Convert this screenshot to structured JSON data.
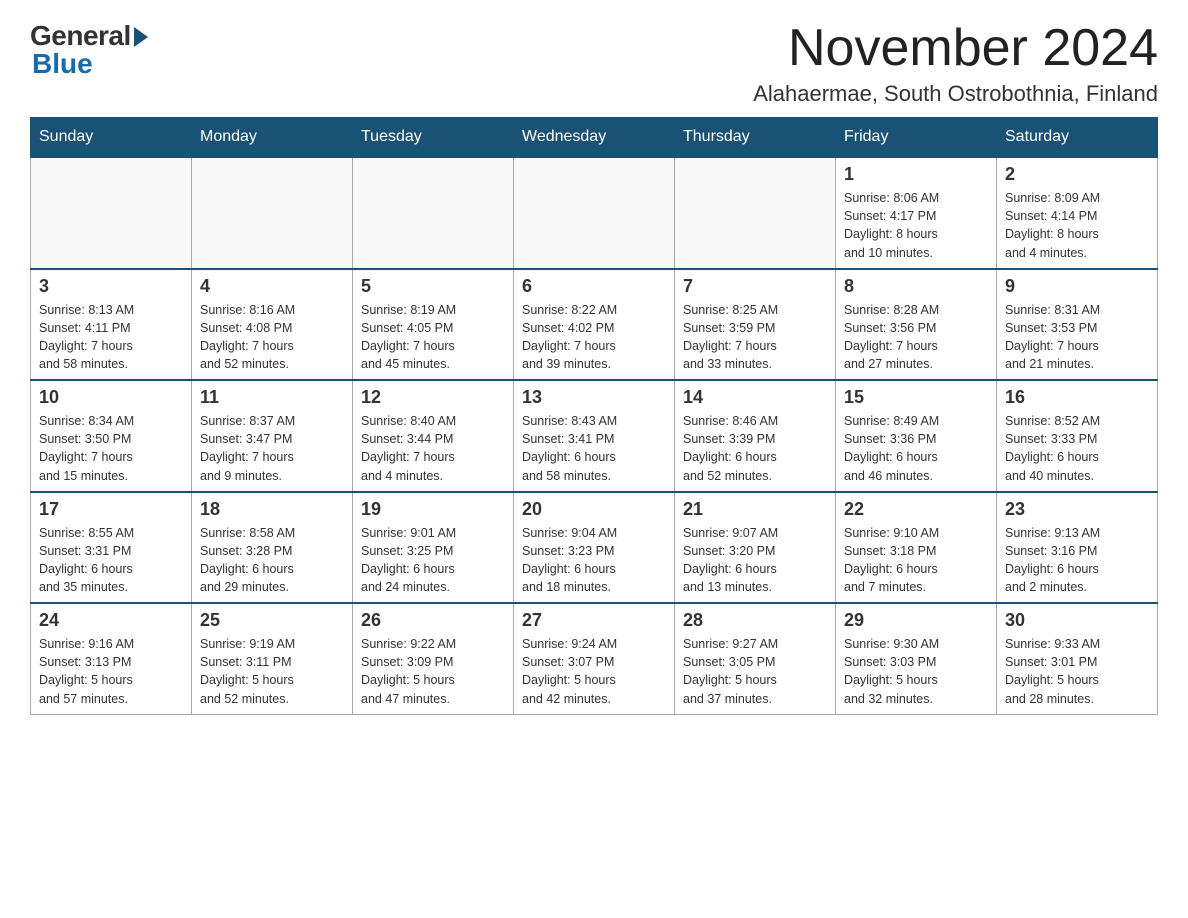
{
  "logo": {
    "general": "General",
    "blue": "Blue"
  },
  "header": {
    "month_year": "November 2024",
    "location": "Alahaermae, South Ostrobothnia, Finland"
  },
  "weekdays": [
    "Sunday",
    "Monday",
    "Tuesday",
    "Wednesday",
    "Thursday",
    "Friday",
    "Saturday"
  ],
  "weeks": [
    {
      "days": [
        {
          "number": "",
          "info": ""
        },
        {
          "number": "",
          "info": ""
        },
        {
          "number": "",
          "info": ""
        },
        {
          "number": "",
          "info": ""
        },
        {
          "number": "",
          "info": ""
        },
        {
          "number": "1",
          "info": "Sunrise: 8:06 AM\nSunset: 4:17 PM\nDaylight: 8 hours\nand 10 minutes."
        },
        {
          "number": "2",
          "info": "Sunrise: 8:09 AM\nSunset: 4:14 PM\nDaylight: 8 hours\nand 4 minutes."
        }
      ]
    },
    {
      "days": [
        {
          "number": "3",
          "info": "Sunrise: 8:13 AM\nSunset: 4:11 PM\nDaylight: 7 hours\nand 58 minutes."
        },
        {
          "number": "4",
          "info": "Sunrise: 8:16 AM\nSunset: 4:08 PM\nDaylight: 7 hours\nand 52 minutes."
        },
        {
          "number": "5",
          "info": "Sunrise: 8:19 AM\nSunset: 4:05 PM\nDaylight: 7 hours\nand 45 minutes."
        },
        {
          "number": "6",
          "info": "Sunrise: 8:22 AM\nSunset: 4:02 PM\nDaylight: 7 hours\nand 39 minutes."
        },
        {
          "number": "7",
          "info": "Sunrise: 8:25 AM\nSunset: 3:59 PM\nDaylight: 7 hours\nand 33 minutes."
        },
        {
          "number": "8",
          "info": "Sunrise: 8:28 AM\nSunset: 3:56 PM\nDaylight: 7 hours\nand 27 minutes."
        },
        {
          "number": "9",
          "info": "Sunrise: 8:31 AM\nSunset: 3:53 PM\nDaylight: 7 hours\nand 21 minutes."
        }
      ]
    },
    {
      "days": [
        {
          "number": "10",
          "info": "Sunrise: 8:34 AM\nSunset: 3:50 PM\nDaylight: 7 hours\nand 15 minutes."
        },
        {
          "number": "11",
          "info": "Sunrise: 8:37 AM\nSunset: 3:47 PM\nDaylight: 7 hours\nand 9 minutes."
        },
        {
          "number": "12",
          "info": "Sunrise: 8:40 AM\nSunset: 3:44 PM\nDaylight: 7 hours\nand 4 minutes."
        },
        {
          "number": "13",
          "info": "Sunrise: 8:43 AM\nSunset: 3:41 PM\nDaylight: 6 hours\nand 58 minutes."
        },
        {
          "number": "14",
          "info": "Sunrise: 8:46 AM\nSunset: 3:39 PM\nDaylight: 6 hours\nand 52 minutes."
        },
        {
          "number": "15",
          "info": "Sunrise: 8:49 AM\nSunset: 3:36 PM\nDaylight: 6 hours\nand 46 minutes."
        },
        {
          "number": "16",
          "info": "Sunrise: 8:52 AM\nSunset: 3:33 PM\nDaylight: 6 hours\nand 40 minutes."
        }
      ]
    },
    {
      "days": [
        {
          "number": "17",
          "info": "Sunrise: 8:55 AM\nSunset: 3:31 PM\nDaylight: 6 hours\nand 35 minutes."
        },
        {
          "number": "18",
          "info": "Sunrise: 8:58 AM\nSunset: 3:28 PM\nDaylight: 6 hours\nand 29 minutes."
        },
        {
          "number": "19",
          "info": "Sunrise: 9:01 AM\nSunset: 3:25 PM\nDaylight: 6 hours\nand 24 minutes."
        },
        {
          "number": "20",
          "info": "Sunrise: 9:04 AM\nSunset: 3:23 PM\nDaylight: 6 hours\nand 18 minutes."
        },
        {
          "number": "21",
          "info": "Sunrise: 9:07 AM\nSunset: 3:20 PM\nDaylight: 6 hours\nand 13 minutes."
        },
        {
          "number": "22",
          "info": "Sunrise: 9:10 AM\nSunset: 3:18 PM\nDaylight: 6 hours\nand 7 minutes."
        },
        {
          "number": "23",
          "info": "Sunrise: 9:13 AM\nSunset: 3:16 PM\nDaylight: 6 hours\nand 2 minutes."
        }
      ]
    },
    {
      "days": [
        {
          "number": "24",
          "info": "Sunrise: 9:16 AM\nSunset: 3:13 PM\nDaylight: 5 hours\nand 57 minutes."
        },
        {
          "number": "25",
          "info": "Sunrise: 9:19 AM\nSunset: 3:11 PM\nDaylight: 5 hours\nand 52 minutes."
        },
        {
          "number": "26",
          "info": "Sunrise: 9:22 AM\nSunset: 3:09 PM\nDaylight: 5 hours\nand 47 minutes."
        },
        {
          "number": "27",
          "info": "Sunrise: 9:24 AM\nSunset: 3:07 PM\nDaylight: 5 hours\nand 42 minutes."
        },
        {
          "number": "28",
          "info": "Sunrise: 9:27 AM\nSunset: 3:05 PM\nDaylight: 5 hours\nand 37 minutes."
        },
        {
          "number": "29",
          "info": "Sunrise: 9:30 AM\nSunset: 3:03 PM\nDaylight: 5 hours\nand 32 minutes."
        },
        {
          "number": "30",
          "info": "Sunrise: 9:33 AM\nSunset: 3:01 PM\nDaylight: 5 hours\nand 28 minutes."
        }
      ]
    }
  ]
}
